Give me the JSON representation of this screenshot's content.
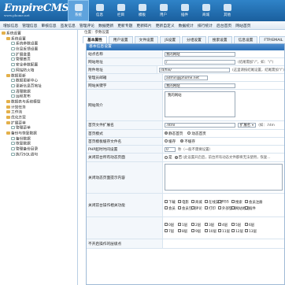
{
  "app": {
    "logo": "EmpireCMS",
    "logo_sub": "www.phome.net",
    "topnav": [
      "系统",
      "信息",
      "栏目",
      "模板",
      "用户",
      "插件",
      "商城",
      "其他"
    ]
  },
  "subnav": [
    "增加信息",
    "管理信息",
    "审核信息",
    "签发信息",
    "管理评论",
    "数据更新",
    "更新专题",
    "更新碎片",
    "更新自定义",
    "数据统计",
    "排行统计",
    "后台首页",
    "网站首页"
  ],
  "sidebar": [
    {
      "label": "系统设置",
      "type": "folder",
      "indent": 0
    },
    {
      "label": "系统设置",
      "type": "folder",
      "indent": 1
    },
    {
      "label": "系统参数设置",
      "type": "page",
      "indent": 2
    },
    {
      "label": "信息反馈设置",
      "type": "page",
      "indent": 2
    },
    {
      "label": "扩展变量",
      "type": "page",
      "indent": 2
    },
    {
      "label": "管理首页",
      "type": "page",
      "indent": 2
    },
    {
      "label": "安全参数配置",
      "type": "page",
      "indent": 2
    },
    {
      "label": "网站防火墙",
      "type": "page",
      "indent": 2
    },
    {
      "label": "数据更新",
      "type": "folder",
      "indent": 1
    },
    {
      "label": "数据更新中心",
      "type": "page",
      "indent": 2
    },
    {
      "label": "更新信息页地址",
      "type": "page",
      "indent": 2
    },
    {
      "label": "清理数据",
      "type": "page",
      "indent": 2
    },
    {
      "label": "远程发布",
      "type": "page",
      "indent": 2
    },
    {
      "label": "数据表与系统模型",
      "type": "folder",
      "indent": 1
    },
    {
      "label": "计划任务",
      "type": "folder",
      "indent": 1
    },
    {
      "label": "工作流",
      "type": "folder",
      "indent": 1
    },
    {
      "label": "优化方案",
      "type": "folder",
      "indent": 1
    },
    {
      "label": "扩展菜单",
      "type": "folder",
      "indent": 1
    },
    {
      "label": "管理菜单",
      "type": "page",
      "indent": 2
    },
    {
      "label": "备份与恢复数据",
      "type": "folder",
      "indent": 1
    },
    {
      "label": "备份数据",
      "type": "page",
      "indent": 2
    },
    {
      "label": "恢复数据",
      "type": "page",
      "indent": 2
    },
    {
      "label": "管理备份目录",
      "type": "page",
      "indent": 2
    },
    {
      "label": "执行SQL语句",
      "type": "page",
      "indent": 2
    }
  ],
  "breadcrumb": "位置：参数设置",
  "tabs": [
    "基本属性",
    "用户设置",
    "文件设置",
    "JS设置",
    "分组设置",
    "搜索设置",
    "信息设置",
    "FTP/EMAIL"
  ],
  "form": {
    "header": "基本信息设置",
    "rows": {
      "site_name": {
        "label": "站点名称",
        "value": "我的网站"
      },
      "site_url": {
        "label": "网站地址",
        "value": "/",
        "hint": "(结尾需加\"/\"，如：\"/\")"
      },
      "attach_url": {
        "label": "附件地址",
        "value": "/d/file/",
        "hint": "(这里请按结尾设置，结尾需加\"/\")"
      },
      "admin_email": {
        "label": "管理员邮箱",
        "value": "admin@phome.net"
      },
      "keywords": {
        "label": "网站关键字",
        "value": "我的网站"
      },
      "description": {
        "label": "网站简介",
        "value": "我的网站"
      },
      "index_ext": {
        "label": "首页文件扩展名",
        "value": ".html",
        "select": "扩展名",
        "hint": "(如：.htm"
      },
      "index_mode": {
        "label": "首页模式",
        "options": [
          "静态首页",
          "动态首页"
        ]
      },
      "index_tpl": {
        "label": "首页模板缓存文件名",
        "options": [
          "缓存",
          "不缓存"
        ]
      },
      "php_delay": {
        "label": "PHP超时时间设置",
        "value": "0",
        "hint": "秒（一般不需要设置）"
      },
      "close_site": {
        "label": "关闭前台所有动态页面",
        "options": [
          "是",
          "否"
        ],
        "hint": "(此设置开启后，前台所有动态文件都将无法使用，恢复..."
      },
      "close_msg": {
        "label": "关闭动态页面提示内容"
      },
      "close_funcs": {
        "label": "关闭前台操作相关功能",
        "items": [
          "下载",
          "电影",
          "商城",
          "在线支付",
          "RSS",
          "搜索",
          "会员注册",
          "会员",
          "会员空间",
          "评论",
          "打印",
          "外部登录",
          "网站地图",
          "插件"
        ]
      },
      "tag_list": {
        "label": "",
        "items": [
          "0层",
          "1层",
          "2层",
          "3层",
          "4层",
          "5层",
          "6层",
          "7层",
          "8层",
          "9层",
          "10层",
          "11层",
          "12层",
          "13层"
        ]
      },
      "footer_partial": {
        "label": "不开启操作的层级点"
      }
    }
  },
  "colors": {
    "topbar": "#2270b3",
    "accent": "#2a6fb6",
    "border": "#9fbad6"
  }
}
